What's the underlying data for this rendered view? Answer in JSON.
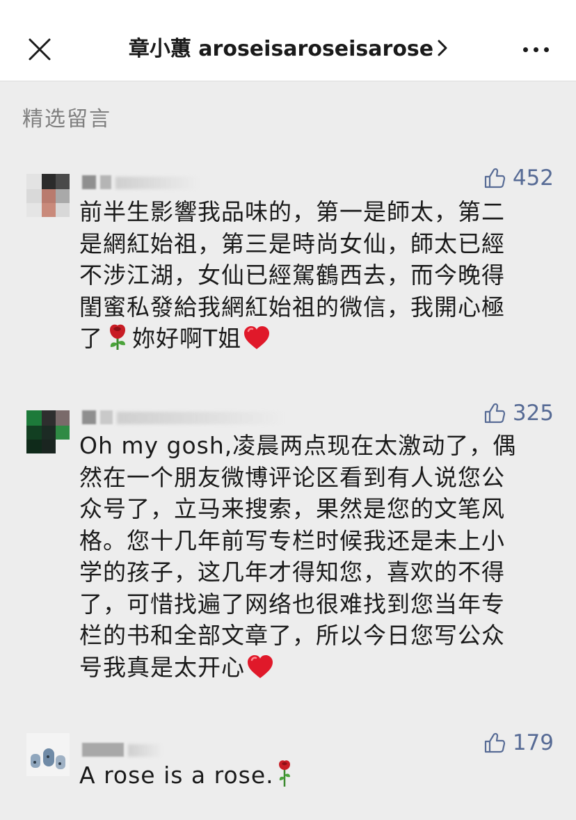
{
  "header": {
    "title": "章小蕙 aroseisaroseisarose"
  },
  "section_label": "精选留言",
  "comments": [
    {
      "likes": "452",
      "body_lines": [
        "前半生影響我品味的，第一是師太，第二",
        "是網紅始祖，第三是時尚女仙，師太已經",
        "不涉江湖，女仙已經駕鶴西去，而今晚得",
        "閨蜜私發給我網紅始祖的微信，我開心極"
      ],
      "last_line_a": "了",
      "last_line_b": "妳好啊T姐",
      "emojis": [
        "rose-icon",
        "heart-icon"
      ]
    },
    {
      "likes": "325",
      "body_lines": [
        "Oh my gosh,凌晨两点现在太激动了，偶",
        "然在一个朋友微博评论区看到有人说您公",
        "众号了，立马来搜索，果然是您的文笔风",
        "格。您十几年前写专栏时候我还是未上小",
        "学的孩子，这几年才得知您，喜欢的不得",
        "了，可惜找遍了网络也很难找到您当年专",
        "栏的书和全部文章了，所以今日您写公众"
      ],
      "last_line_a": "号我真是太开心",
      "emojis": [
        "heart-icon"
      ]
    },
    {
      "likes": "179",
      "body_text": "A rose is a rose.",
      "emojis": [
        "rose-stem-icon"
      ]
    }
  ],
  "colors": {
    "link": "#576b95",
    "background": "#ededed",
    "muted": "#7f7f7f"
  }
}
